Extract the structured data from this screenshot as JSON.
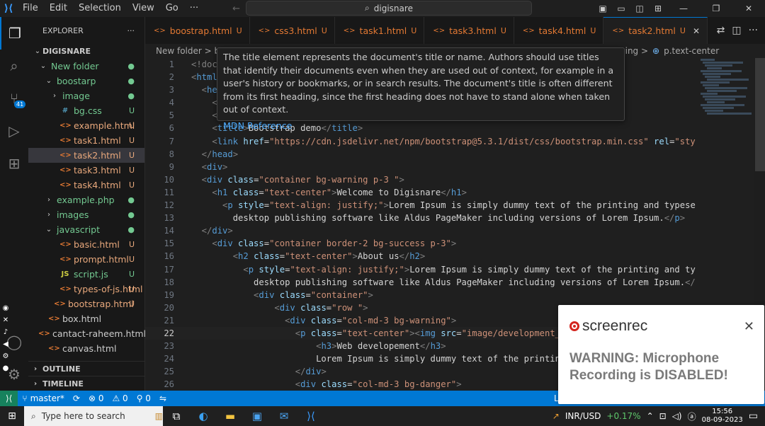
{
  "menu": [
    "File",
    "Edit",
    "Selection",
    "View",
    "Go",
    "···"
  ],
  "command_center": "digisnare",
  "activity": {
    "scm_badge": "41"
  },
  "explorer": {
    "title": "EXPLORER",
    "more": "···",
    "root": "DIGISNARE",
    "items": [
      {
        "label": "New folder",
        "kind": "folder",
        "open": true,
        "depth": 1,
        "status": "●",
        "tone": "green"
      },
      {
        "label": "boostarp",
        "kind": "folder",
        "open": true,
        "depth": 2,
        "status": "●",
        "tone": "green"
      },
      {
        "label": "image",
        "kind": "folder",
        "open": false,
        "depth": 3,
        "status": "●",
        "tone": "green"
      },
      {
        "label": "bg.css",
        "kind": "css",
        "depth": 3,
        "status": "U",
        "tone": "green"
      },
      {
        "label": "example.html",
        "kind": "html",
        "depth": 3,
        "status": "U",
        "tone": "orange"
      },
      {
        "label": "task1.html",
        "kind": "html",
        "depth": 3,
        "status": "U",
        "tone": "orange"
      },
      {
        "label": "task2.html",
        "kind": "html",
        "depth": 3,
        "status": "U",
        "tone": "orange",
        "selected": true
      },
      {
        "label": "task3.html",
        "kind": "html",
        "depth": 3,
        "status": "U",
        "tone": "orange"
      },
      {
        "label": "task4.html",
        "kind": "html",
        "depth": 3,
        "status": "U",
        "tone": "orange"
      },
      {
        "label": "example.php",
        "kind": "folder",
        "open": false,
        "depth": 2,
        "status": "●",
        "tone": "green"
      },
      {
        "label": "images",
        "kind": "folder",
        "open": false,
        "depth": 2,
        "status": "●",
        "tone": "green"
      },
      {
        "label": "javascript",
        "kind": "folder",
        "open": true,
        "depth": 2,
        "status": "●",
        "tone": "green"
      },
      {
        "label": "basic.html",
        "kind": "html",
        "depth": 3,
        "status": "U",
        "tone": "orange"
      },
      {
        "label": "prompt.html",
        "kind": "html",
        "depth": 3,
        "status": "U",
        "tone": "orange"
      },
      {
        "label": "script.js",
        "kind": "js",
        "depth": 3,
        "status": "U",
        "tone": "green"
      },
      {
        "label": "types-of-js.html",
        "kind": "html",
        "depth": 3,
        "status": "U",
        "tone": "orange"
      },
      {
        "label": "bootstrap.html",
        "kind": "html",
        "depth": 2,
        "status": "U",
        "tone": "orange"
      },
      {
        "label": "box.html",
        "kind": "html",
        "depth": 1,
        "status": "",
        "tone": "plain"
      },
      {
        "label": "cantact-raheem.html",
        "kind": "html",
        "depth": 1,
        "status": "",
        "tone": "plain"
      },
      {
        "label": "canvas.html",
        "kind": "html",
        "depth": 1,
        "status": "",
        "tone": "plain"
      }
    ],
    "outline": "OUTLINE",
    "timeline": "TIMELINE"
  },
  "tabs": [
    {
      "label": "boostrap.html",
      "u": "U",
      "active": false
    },
    {
      "label": "css3.html",
      "u": "U",
      "active": false
    },
    {
      "label": "task1.html",
      "u": "U",
      "active": false
    },
    {
      "label": "task3.html",
      "u": "U",
      "active": false
    },
    {
      "label": "task4.html",
      "u": "U",
      "active": false
    },
    {
      "label": "task2.html",
      "u": "U",
      "active": true
    }
  ],
  "breadcrumb": {
    "left": "New folder  >  bo",
    "right_prefix": "ning  >",
    "right": "p.text-center"
  },
  "hover": {
    "text": "The title element represents the document's title or name. Authors should use titles that identify their documents even when they are used out of context, for example in a user's history or bookmarks, or in search results. The document's title is often different from its first heading, since the first heading does not have to stand alone when taken out of context.",
    "link": "MDN Reference"
  },
  "code_lines": [
    [
      [
        "p",
        "<!doc"
      ]
    ],
    [
      [
        "p",
        "<"
      ],
      [
        "t",
        "html"
      ]
    ],
    [
      [
        "p",
        "  <"
      ],
      [
        "t",
        "he"
      ]
    ],
    [
      [
        "p",
        "    <"
      ]
    ],
    [
      [
        "p",
        "    <"
      ]
    ],
    [
      [
        "p",
        "    <"
      ],
      [
        "t",
        "title"
      ],
      [
        "p",
        ">"
      ],
      [
        "tx",
        "Bootstrap demo"
      ],
      [
        "p",
        "</"
      ],
      [
        "t",
        "title"
      ],
      [
        "p",
        ">"
      ]
    ],
    [
      [
        "p",
        "    <"
      ],
      [
        "t",
        "link "
      ],
      [
        "a",
        "href"
      ],
      [
        "tx",
        "="
      ],
      [
        "s",
        "\"https://cdn.jsdelivr.net/npm/bootstrap@5.3.1/dist/css/bootstrap.min.css\""
      ],
      [
        "a",
        " rel"
      ],
      [
        "tx",
        "="
      ],
      [
        "s",
        "\"sty"
      ]
    ],
    [
      [
        "p",
        "  </"
      ],
      [
        "t",
        "head"
      ],
      [
        "p",
        ">"
      ]
    ],
    [
      [
        "p",
        "  <"
      ],
      [
        "t",
        "div"
      ],
      [
        "p",
        ">"
      ]
    ],
    [
      [
        "p",
        "  <"
      ],
      [
        "t",
        "div "
      ],
      [
        "a",
        "class"
      ],
      [
        "tx",
        "="
      ],
      [
        "s",
        "\"container bg-warning p-3 \""
      ],
      [
        "p",
        ">"
      ]
    ],
    [
      [
        "p",
        "    <"
      ],
      [
        "t",
        "h1 "
      ],
      [
        "a",
        "class"
      ],
      [
        "tx",
        "="
      ],
      [
        "s",
        "\"text-center\""
      ],
      [
        "p",
        ">"
      ],
      [
        "tx",
        "Welcome to Digisnare"
      ],
      [
        "p",
        "</"
      ],
      [
        "t",
        "h1"
      ],
      [
        "p",
        ">"
      ]
    ],
    [
      [
        "p",
        "      <"
      ],
      [
        "t",
        "p "
      ],
      [
        "a",
        "style"
      ],
      [
        "tx",
        "="
      ],
      [
        "s",
        "\"text-align: justify;\""
      ],
      [
        "p",
        ">"
      ],
      [
        "tx",
        "Lorem Ipsum is simply dummy text of the printing and typese"
      ]
    ],
    [
      [
        "tx",
        "        desktop publishing software like Aldus PageMaker including versions of Lorem Ipsum."
      ],
      [
        "p",
        "</"
      ],
      [
        "t",
        "p"
      ],
      [
        "p",
        ">"
      ]
    ],
    [
      [
        "p",
        "  </"
      ],
      [
        "t",
        "div"
      ],
      [
        "p",
        ">"
      ]
    ],
    [
      [
        "p",
        "    <"
      ],
      [
        "t",
        "div "
      ],
      [
        "a",
        "class"
      ],
      [
        "tx",
        "="
      ],
      [
        "s",
        "\"container border-2 bg-success p-3\""
      ],
      [
        "p",
        ">"
      ]
    ],
    [
      [
        "p",
        "        <"
      ],
      [
        "t",
        "h2 "
      ],
      [
        "a",
        "class"
      ],
      [
        "tx",
        "="
      ],
      [
        "s",
        "\"text-center\""
      ],
      [
        "p",
        ">"
      ],
      [
        "tx",
        "About us"
      ],
      [
        "p",
        "</"
      ],
      [
        "t",
        "h2"
      ],
      [
        "p",
        ">"
      ]
    ],
    [
      [
        "p",
        "          <"
      ],
      [
        "t",
        "p "
      ],
      [
        "a",
        "style"
      ],
      [
        "tx",
        "="
      ],
      [
        "s",
        "\"text-align: justify;\""
      ],
      [
        "p",
        ">"
      ],
      [
        "tx",
        "Lorem Ipsum is simply dummy text of the printing and ty"
      ]
    ],
    [
      [
        "tx",
        "            desktop publishing software like Aldus PageMaker including versions of Lorem Ipsum."
      ],
      [
        "p",
        "</"
      ]
    ],
    [
      [
        "p",
        "            <"
      ],
      [
        "t",
        "div "
      ],
      [
        "a",
        "class"
      ],
      [
        "tx",
        "="
      ],
      [
        "s",
        "\"container\""
      ],
      [
        "p",
        ">"
      ]
    ],
    [
      [
        "p",
        "                <"
      ],
      [
        "t",
        "div "
      ],
      [
        "a",
        "class"
      ],
      [
        "tx",
        "="
      ],
      [
        "s",
        "\"row \""
      ],
      [
        "p",
        ">"
      ]
    ],
    [
      [
        "p",
        "                  <"
      ],
      [
        "t",
        "div "
      ],
      [
        "a",
        "class"
      ],
      [
        "tx",
        "="
      ],
      [
        "s",
        "\"col-md-3 bg-warning\""
      ],
      [
        "p",
        ">"
      ]
    ],
    [
      [
        "p",
        "                    <"
      ],
      [
        "t",
        "p "
      ],
      [
        "a",
        "class"
      ],
      [
        "tx",
        "="
      ],
      [
        "s",
        "\"text-center\""
      ],
      [
        "p",
        "><"
      ],
      [
        "t",
        "img "
      ],
      [
        "a",
        "src"
      ],
      [
        "tx",
        "="
      ],
      [
        "s",
        "\"image/development_"
      ]
    ],
    [
      [
        "p",
        "                        <"
      ],
      [
        "t",
        "h3"
      ],
      [
        "p",
        ">"
      ],
      [
        "tx",
        "Web developement"
      ],
      [
        "p",
        "</"
      ],
      [
        "t",
        "h3"
      ],
      [
        "p",
        ">"
      ]
    ],
    [
      [
        "tx",
        "                        Lorem Ipsum is simply dummy text of the printing"
      ]
    ],
    [
      [
        "p",
        "                    </"
      ],
      [
        "t",
        "div"
      ],
      [
        "p",
        ">"
      ]
    ],
    [
      [
        "p",
        "                    <"
      ],
      [
        "t",
        "div "
      ],
      [
        "a",
        "class"
      ],
      [
        "tx",
        "="
      ],
      [
        "s",
        "\"col-md-3 bg-danger\""
      ],
      [
        "p",
        ">"
      ]
    ]
  ],
  "current_line": 22,
  "status": {
    "branch": "master*",
    "sync": "⟳",
    "errors": "⊗ 0",
    "warnings": "⚠ 0",
    "ports": "⚲ 0",
    "right": "Ln"
  },
  "taskbar": {
    "search": "Type here to search",
    "ticker": "INR/USD",
    "ticker_change": "+0.17%",
    "time": "15:56",
    "date": "08-09-2023"
  },
  "toast": {
    "brand": "screenrec",
    "message": "WARNING: Microphone Recording is DISABLED!"
  },
  "colors": {
    "accent": "#0078d4",
    "html_icon": "#e37933",
    "untracked": "#73c991"
  }
}
